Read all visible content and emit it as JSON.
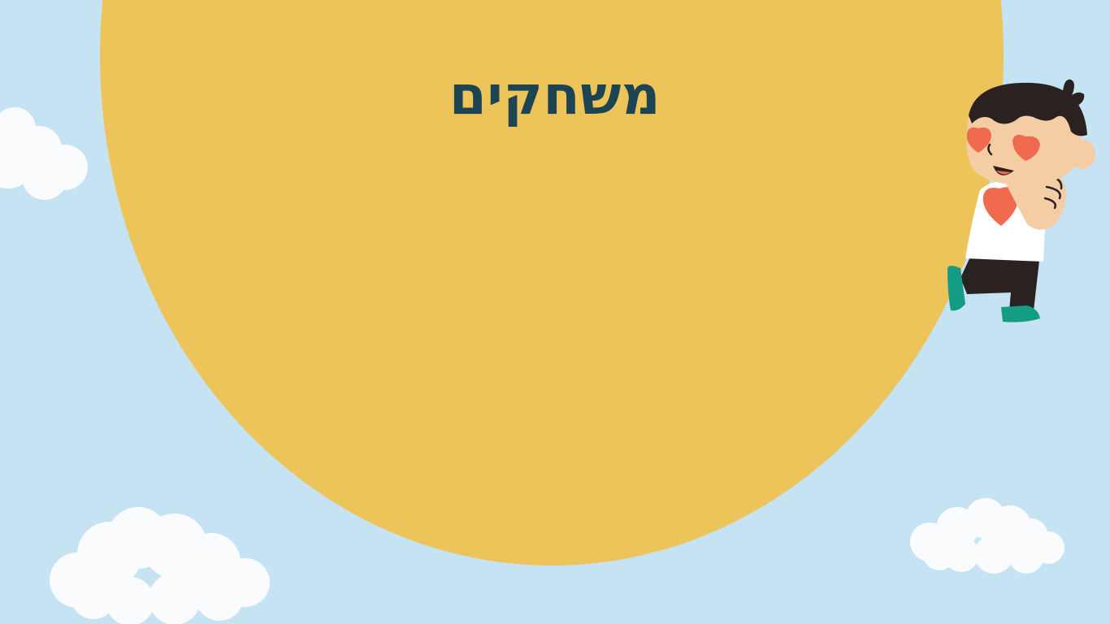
{
  "slide": {
    "title": "משחקים"
  },
  "colors": {
    "sky": "#c5e3f3",
    "sun": "#ecc45a",
    "title": "#1d4452",
    "cloud": "#f9fbfc",
    "skin": "#f5cda4",
    "hair": "#2a2221",
    "heart": "#f06a4f",
    "shirt": "#ffffff",
    "pants": "#2a2221",
    "shoes": "#149c84"
  },
  "illustrations": {
    "character": "happy-boy-heart-eyes",
    "clouds": [
      "cloud-left-top",
      "cloud-left-bottom",
      "cloud-right-bottom"
    ]
  }
}
